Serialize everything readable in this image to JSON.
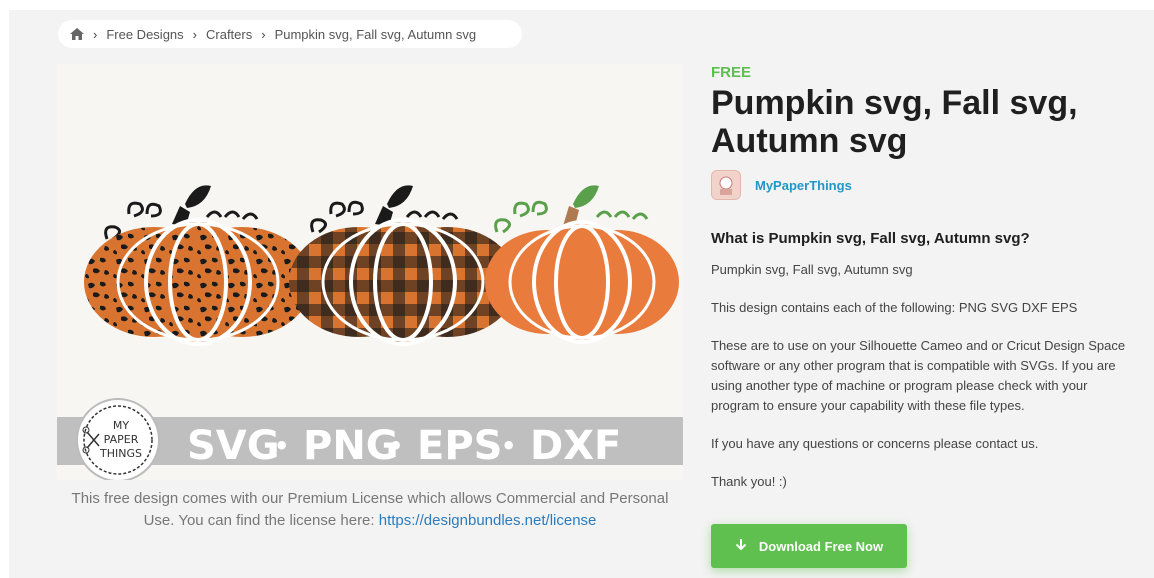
{
  "breadcrumb": {
    "home_icon": "home-icon",
    "items": [
      "Free Designs",
      "Crafters",
      "Pumpkin svg, Fall svg, Autumn svg"
    ],
    "separator": "›"
  },
  "product": {
    "badge": "FREE",
    "title": "Pumpkin svg, Fall svg, Autumn svg",
    "author": "MyPaperThings",
    "image": {
      "banner_text": [
        "SVG",
        "•",
        "PNG",
        "•",
        "EPS",
        "•",
        "DXF"
      ],
      "logo_text": [
        "MY",
        "PAPER",
        "THINGS"
      ]
    }
  },
  "license": {
    "text": "This free design comes with our Premium License which allows Commercial and Personal Use. You can find the license here: ",
    "link": "https://designbundles.net/license"
  },
  "description": {
    "heading": "What is Pumpkin svg, Fall svg, Autumn svg?",
    "paragraphs": [
      "Pumpkin svg, Fall svg, Autumn svg",
      "This design contains each of the following: PNG SVG DXF EPS",
      "These are to use on your Silhouette Cameo and or Cricut Design Space software or any other program that is compatible with SVGs. If you are using another type of machine or program please check with your program to ensure your capability with these file types.",
      "If you have any questions or concerns please contact us.",
      "Thank you! :)"
    ]
  },
  "download": {
    "label": "Download Free Now",
    "icon": "download-arrow-icon"
  },
  "colors": {
    "accent_green": "#5fbf4f",
    "link_blue": "#2196c9",
    "pumpkin_orange": "#e97b3d"
  }
}
